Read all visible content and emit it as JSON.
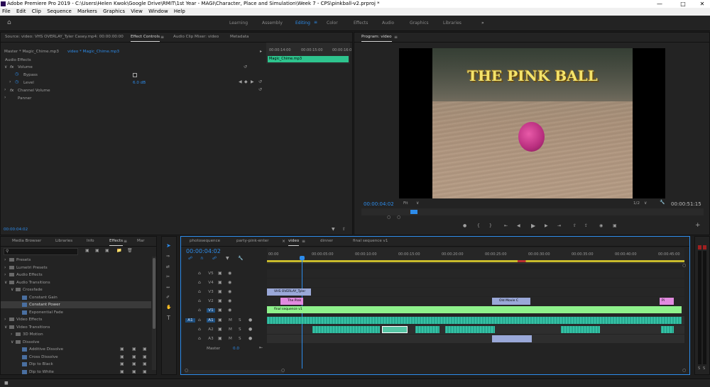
{
  "title_bar": {
    "text": "Adobe Premiere Pro 2019 - C:\\Users\\Helen Kwok\\Google Drive\\RMIT\\1st Year - MAGI\\Character, Place and Simulation\\Week 7 - CPS\\pinkball-v2.prproj *",
    "minimize": "—",
    "maximize": "□",
    "close": "✕"
  },
  "menu": [
    "File",
    "Edit",
    "Clip",
    "Sequence",
    "Markers",
    "Graphics",
    "View",
    "Window",
    "Help"
  ],
  "workspaces": [
    "Learning",
    "Assembly",
    "Editing",
    "Color",
    "Effects",
    "Audio",
    "Graphics",
    "Libraries"
  ],
  "workspace_active": "Editing",
  "workspace_more": "»",
  "source_panel": {
    "tabs": [
      "Source: video: VHS OVERLAY_Tyler Casey.mp4: 00:00:00:00",
      "Effect Controls",
      "Audio Clip Mixer: video",
      "Metadata"
    ],
    "master_label": "Master * Magic_Chime.mp3",
    "clip_label": "video * Magic_Chime.mp3",
    "section": "Audio Effects",
    "fx_volume": "Volume",
    "bypass": "Bypass",
    "level": "Level",
    "level_value": "6.0 dB",
    "channel_volume": "Channel Volume",
    "panner": "Panner",
    "mini_timecodes": [
      "00:00:14:00",
      "00:00:15:00",
      "00:00:16:0"
    ],
    "mini_clip": "Magic_Chime.mp3",
    "timecode": "00:00:04:02"
  },
  "program_monitor": {
    "tab": "Program: video",
    "overlay_title": "THE PINK BALL",
    "timecode": "00:00:04:02",
    "fit": "Fit",
    "resolution": "1/2",
    "duration": "00:00:51:15"
  },
  "effects_panel": {
    "tabs": [
      "Media Browser",
      "Libraries",
      "Info",
      "Effects",
      "Mar"
    ],
    "tree": [
      {
        "label": "Presets",
        "depth": 0
      },
      {
        "label": "Lumetri Presets",
        "depth": 0
      },
      {
        "label": "Audio Effects",
        "depth": 0
      },
      {
        "label": "Audio Transitions",
        "depth": 0
      },
      {
        "label": "Crossfade",
        "depth": 1
      },
      {
        "label": "Constant Gain",
        "depth": 2
      },
      {
        "label": "Constant Power",
        "depth": 2
      },
      {
        "label": "Exponential Fade",
        "depth": 2
      },
      {
        "label": "Video Effects",
        "depth": 0
      },
      {
        "label": "Video Transitions",
        "depth": 0
      },
      {
        "label": "3D Motion",
        "depth": 1
      },
      {
        "label": "Dissolve",
        "depth": 1
      },
      {
        "label": "Additive Dissolve",
        "depth": 2
      },
      {
        "label": "Cross Dissolve",
        "depth": 2
      },
      {
        "label": "Dip to Black",
        "depth": 2
      },
      {
        "label": "Dip to White",
        "depth": 2
      }
    ]
  },
  "timeline": {
    "tabs": [
      "photosequence",
      "party-pink-enter",
      "video",
      "dinner",
      "final sequence v1"
    ],
    "timecode": "00:00:04:02",
    "ruler": [
      "00:00",
      "00:00:05:00",
      "00:00:10:00",
      "00:00:15:00",
      "00:00:20:00",
      "00:00:25:00",
      "00:00:30:00",
      "00:00:35:00",
      "00:00:40:00",
      "00:00:45:00"
    ],
    "tracks_video": [
      "V5",
      "V4",
      "V3",
      "V2",
      "V1"
    ],
    "tracks_audio": [
      "A1",
      "A2",
      "A3"
    ],
    "master": "Master",
    "master_value": "0.0",
    "src_patch": "A1",
    "clips": {
      "vhs": "VHS OVERLAY_Tyler",
      "pink": "The Pink",
      "old_movie": "Old Movie C",
      "pi": "Pi",
      "final_seq": "final sequence v1"
    },
    "meter_labels": [
      "S",
      "S"
    ]
  }
}
